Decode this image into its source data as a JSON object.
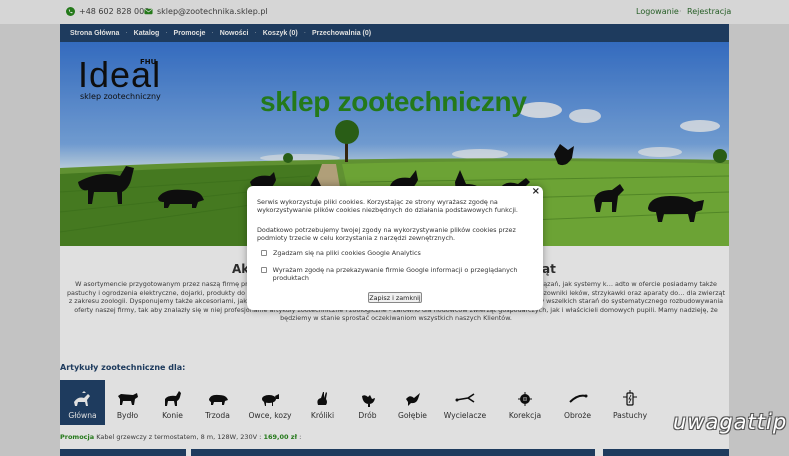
{
  "topbar": {
    "phone": "+48 602 828 000",
    "email": "sklep@zootechnika.sklep.pl",
    "login": "Logowanie",
    "register": "Rejestracja",
    "separator": "·"
  },
  "nav": {
    "items": [
      "Strona Główna",
      "Katalog",
      "Promocje",
      "Nowości",
      "Koszyk (0)",
      "Przechowalnia (0)"
    ],
    "separator": "·"
  },
  "banner": {
    "logo_main": "Ideal",
    "logo_fhu": "FHU",
    "logo_sub": "sklep zootechniczny",
    "slogan": "sklep zootechniczny"
  },
  "content": {
    "title_left": "Ak",
    "title_right": "ąt",
    "text": "W asortymencie przygotowanym przez naszą firmę pr… artykuły dla zwierząt domowych. Specjalizujemy się w dostarczaniu Klientom takich rozwiązań, jak systemy k… adto w ofercie posiadamy także pastuchy i ogrodzenia elektryczne, dojarki, produkty do pielęgnacji skóry i sierś… my FHU Ideal, to również produkty z zakresu weterynarii - m.in. dozowniki leków, strzykawki oraz aparaty do… dla zwierząt z zakresu zoologii. Dysponujemy także akcesoriami, jak kuwety, klatki, transportery, smycze, legowiska, miski, kojce, a także szampony. Dokładamy wszelkich starań do systematycznego rozbudowywania oferty naszej firmy, tak aby znalazły się w niej profesjonalne artykuły zootechniczne i zoologiczne - zarówno dla hodowców zwierząt gospodarczych, jak i właścicieli domowych pupili. Mamy nadzieję, że będziemy w stanie sprostać oczekiwaniom wszystkich naszych Klientów."
  },
  "articles": {
    "title": "Artykuły zootechniczne dla:",
    "tiles": [
      {
        "label": "Główna",
        "icon": "home-animals-icon",
        "active": true
      },
      {
        "label": "Bydło",
        "icon": "cow-icon"
      },
      {
        "label": "Konie",
        "icon": "horse-icon"
      },
      {
        "label": "Trzoda",
        "icon": "pig-icon"
      },
      {
        "label": "Owce, kozy",
        "icon": "sheep-icon"
      },
      {
        "label": "Króliki",
        "icon": "rabbit-icon"
      },
      {
        "label": "Drób",
        "icon": "hen-icon"
      },
      {
        "label": "Gołębie",
        "icon": "pigeon-icon"
      },
      {
        "label": "Wycielacze",
        "icon": "calving-aid-icon"
      },
      {
        "label": "Korekcja",
        "icon": "hoof-correction-icon"
      },
      {
        "label": "Obroże",
        "icon": "collar-icon"
      },
      {
        "label": "Pastuchy",
        "icon": "electric-fence-icon"
      }
    ]
  },
  "promo": {
    "label": "Promocja",
    "text": "Kabel grzewczy z termostatem, 8 m, 128W, 230V",
    "sep": ":",
    "price": "169,00 zł",
    "trail": ":"
  },
  "cookie_modal": {
    "close": "×",
    "para1": "Serwis wykorzystuje pliki cookies. Korzystając ze strony wyrażasz zgodę na wykorzystywanie plików cookies niezbędnych do działania podstawowych funkcji.",
    "para2": "Dodatkowo potrzebujemy twojej zgody na wykorzystywanie plików cookies przez podmioty trzecie w celu korzystania z narzędzi zewnętrznych.",
    "option1": "Zgadzam się na pliki cookies Google Analytics",
    "option2": "Wyrażam zgodę na przekazywanie firmie Google informacji o przeglądanych produktach",
    "save": "Zapisz i zamknij"
  },
  "watermark": "uwagattip",
  "colors": {
    "nav": "#23446b",
    "brand_green": "#2a8a1e"
  }
}
